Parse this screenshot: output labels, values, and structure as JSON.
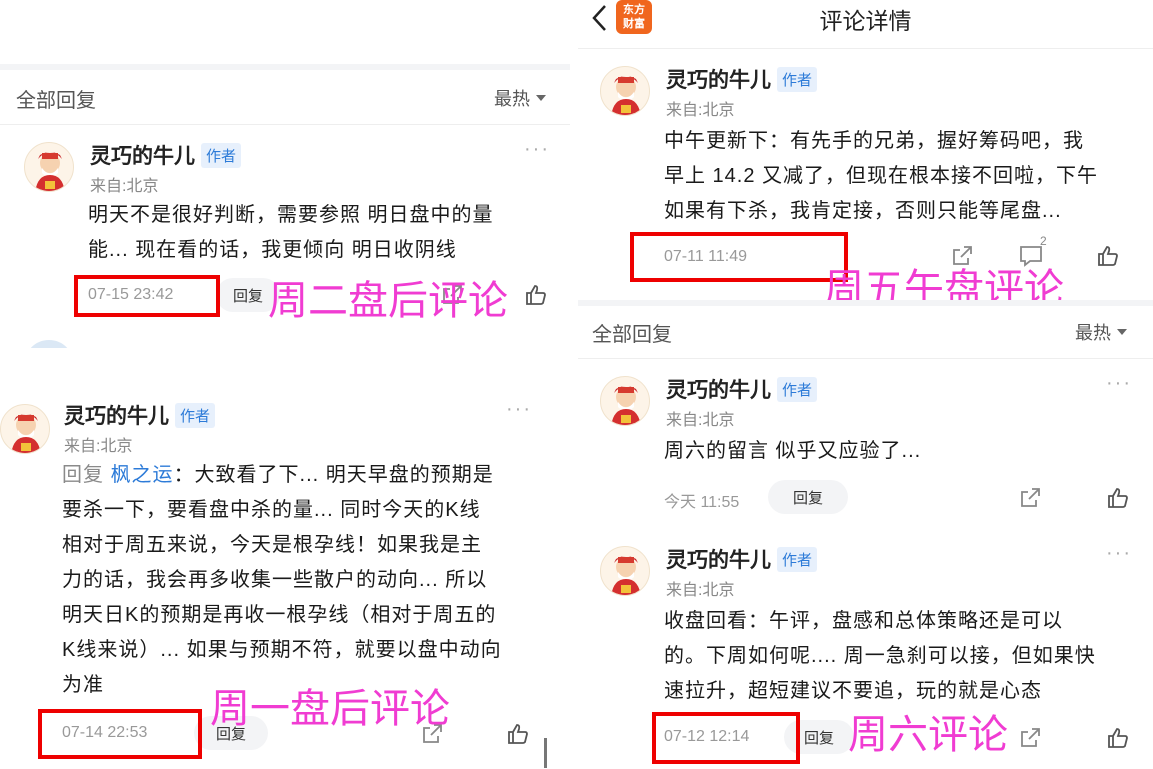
{
  "header": {
    "title": "评论详情",
    "app_logo_line1": "东方",
    "app_logo_line2": "财富"
  },
  "left_top": {
    "section_title": "全部回复",
    "sort_label": "最热",
    "comment": {
      "author": "灵巧的牛儿",
      "badge": "作者",
      "location": "来自:北京",
      "lines": [
        "明天不是很好判断，需要参照 明日盘中的量",
        "能... 现在看的话，我更倾向 明日收阴线"
      ],
      "time": "07-15 23:42",
      "reply_label": "回复"
    },
    "annotation": "周二盘后评论"
  },
  "left_bottom": {
    "comment": {
      "author": "灵巧的牛儿",
      "badge": "作者",
      "location": "来自:北京",
      "reply_prefix": "回复",
      "mention": "枫之运",
      "first_line_rest": "：大致看了下... 明天早盘的预期是",
      "lines": [
        "要杀一下，要看盘中杀的量... 同时今天的K线",
        "相对于周五来说，今天是根孕线！如果我是主",
        "力的话，我会再多收集一些散户的动向... 所以",
        "明天日K的预期是再收一根孕线（相对于周五的",
        "K线来说）... 如果与预期不符，就要以盘中动向",
        "为准"
      ],
      "time": "07-14 22:53",
      "reply_label": "回复"
    },
    "annotation": "周一盘后评论"
  },
  "right_top": {
    "comment": {
      "author": "灵巧的牛儿",
      "badge": "作者",
      "location": "来自:北京",
      "lines": [
        "中午更新下：有先手的兄弟，握好筹码吧，我",
        "早上 14.2 又减了，但现在根本接不回啦，下午",
        "如果有下杀，我肯定接，否则只能等尾盘..."
      ],
      "time": "07-11 11:49",
      "comment_count": "2"
    },
    "annotation": "周五午盘评论"
  },
  "right_bottom": {
    "section_title": "全部回复",
    "sort_label": "最热",
    "comment1": {
      "author": "灵巧的牛儿",
      "badge": "作者",
      "location": "来自:北京",
      "lines": [
        "周六的留言 似乎又应验了..."
      ],
      "time": "今天 11:55",
      "reply_label": "回复"
    },
    "comment2": {
      "author": "灵巧的牛儿",
      "badge": "作者",
      "location": "来自:北京",
      "lines": [
        "收盘回看：午评，盘感和总体策略还是可以",
        "的。下周如何呢.... 周一急刹可以接，但如果快",
        "速拉升，超短建议不要追，玩的就是心态"
      ],
      "time": "07-12 12:14",
      "reply_label": "回复"
    },
    "annotation": "周六评论"
  },
  "colors": {
    "annotation": "#f03cd2",
    "highlight_box": "#ee0000",
    "badge_text": "#2d7bd8",
    "logo_bg": "#f0661e"
  }
}
